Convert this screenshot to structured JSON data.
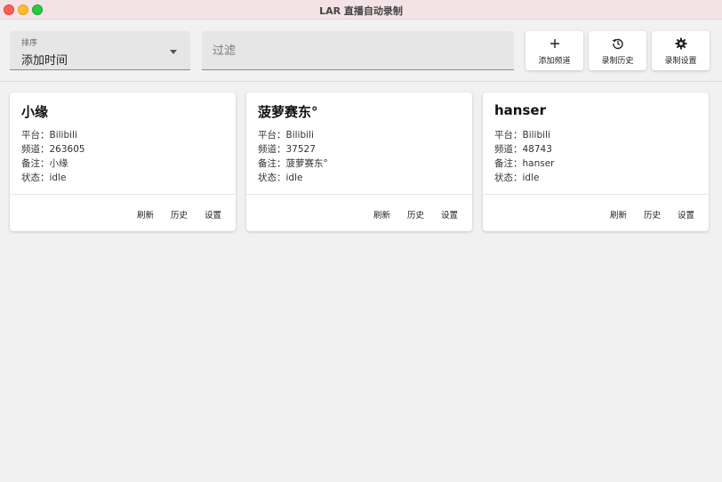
{
  "window": {
    "title": "LAR 直播自动录制"
  },
  "toolbar": {
    "sort": {
      "label": "排序",
      "value": "添加时间"
    },
    "filter": {
      "placeholder": "过滤",
      "value": ""
    },
    "buttons": {
      "add": {
        "label": "添加频道",
        "icon": "plus-icon"
      },
      "history": {
        "label": "录制历史",
        "icon": "history-icon"
      },
      "settings": {
        "label": "录制设置",
        "icon": "gear-icon"
      }
    }
  },
  "channels": [
    {
      "name": "小缘",
      "platform_label": "平台：",
      "platform": "Bilibili",
      "channel_label": "频道：",
      "channel": "263605",
      "note_label": "备注：",
      "note": "小缘",
      "status_label": "状态：",
      "status": "idle",
      "actions": {
        "refresh": "刷新",
        "history": "历史",
        "settings": "设置"
      }
    },
    {
      "name": "菠萝赛东°",
      "platform_label": "平台：",
      "platform": "Bilibili",
      "channel_label": "频道：",
      "channel": "37527",
      "note_label": "备注：",
      "note": "菠萝赛东°",
      "status_label": "状态：",
      "status": "idle",
      "actions": {
        "refresh": "刷新",
        "history": "历史",
        "settings": "设置"
      }
    },
    {
      "name": "hanser",
      "platform_label": "平台：",
      "platform": "Bilibili",
      "channel_label": "频道：",
      "channel": "48743",
      "note_label": "备注：",
      "note": "hanser",
      "status_label": "状态：",
      "status": "idle",
      "actions": {
        "refresh": "刷新",
        "history": "历史",
        "settings": "设置"
      }
    }
  ],
  "colors": {
    "titlebar": "#f3e3e6",
    "background": "#f1f1f1",
    "field": "#e6e6e6",
    "card": "#ffffff"
  }
}
